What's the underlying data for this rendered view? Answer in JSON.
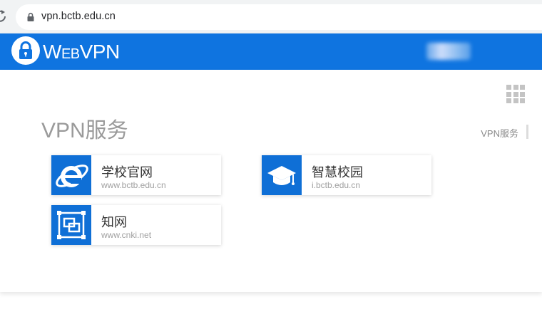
{
  "browser": {
    "url": "vpn.bctb.edu.cn"
  },
  "header": {
    "logo_text_prefix": "W",
    "logo_text_middle": "EB",
    "logo_text_suffix": "VPN",
    "brand_color": "#0f74e0"
  },
  "main": {
    "title": "VPN服务",
    "side_label": "VPN服务",
    "cards": [
      {
        "name": "学校官网",
        "url": "www.bctb.edu.cn",
        "icon": "internet-explorer-icon"
      },
      {
        "name": "智慧校园",
        "url": "i.bctb.edu.cn",
        "icon": "graduation-cap-icon"
      },
      {
        "name": "知网",
        "url": "www.cnki.net",
        "icon": "frame-icon"
      }
    ]
  }
}
